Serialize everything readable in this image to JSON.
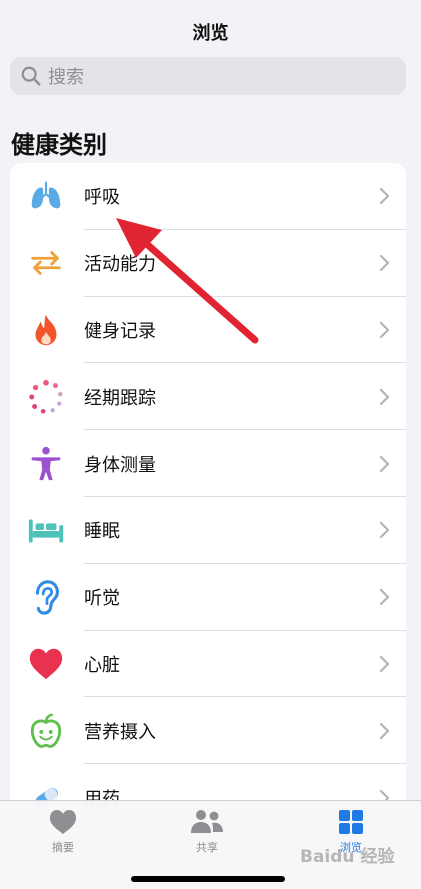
{
  "header": {
    "title": "浏览"
  },
  "search": {
    "placeholder": "搜索"
  },
  "section": {
    "title": "健康类别"
  },
  "categories": [
    {
      "label": "呼吸",
      "icon": "lungs-icon",
      "color": "#5aaae6"
    },
    {
      "label": "活动能力",
      "icon": "arrows-icon",
      "color": "#f0a23a"
    },
    {
      "label": "健身记录",
      "icon": "flame-icon",
      "color": "#f2552c"
    },
    {
      "label": "经期跟踪",
      "icon": "cycle-dots-icon",
      "color": "#e2446d"
    },
    {
      "label": "身体测量",
      "icon": "person-icon",
      "color": "#9b52cf"
    },
    {
      "label": "睡眠",
      "icon": "bed-icon",
      "color": "#4cc2b9"
    },
    {
      "label": "听觉",
      "icon": "ear-icon",
      "color": "#2f8be6"
    },
    {
      "label": "心脏",
      "icon": "heart-icon",
      "color": "#e8324f"
    },
    {
      "label": "营养摄入",
      "icon": "apple-icon",
      "color": "#5cc04a"
    },
    {
      "label": "用药",
      "icon": "pills-icon",
      "color": "#5aa8e6"
    }
  ],
  "tabbar": {
    "tabs": [
      {
        "label": "摘要",
        "icon": "heart-tab-icon"
      },
      {
        "label": "共享",
        "icon": "people-icon"
      },
      {
        "label": "浏览",
        "icon": "grid-icon",
        "active": true
      }
    ],
    "accent": "#1f7ae6"
  },
  "watermark": "Baidu 经验"
}
